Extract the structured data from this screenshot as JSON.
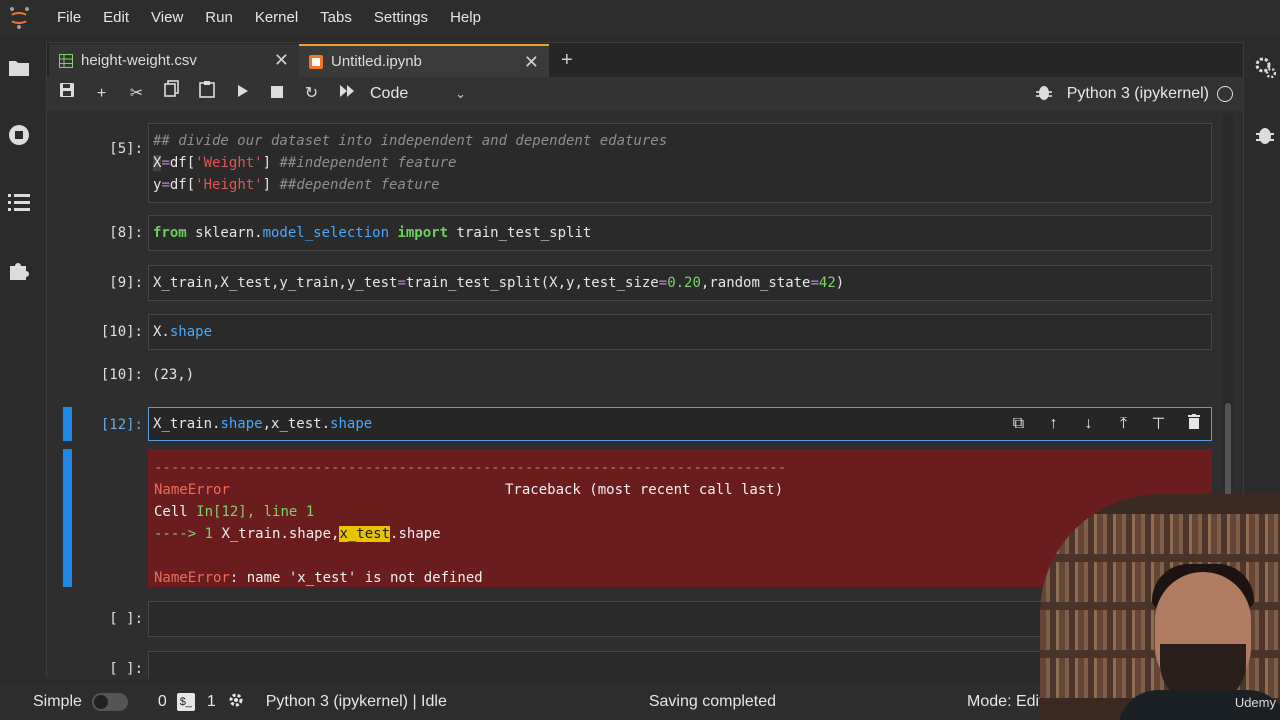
{
  "menubar": {
    "items": [
      "File",
      "Edit",
      "View",
      "Run",
      "Kernel",
      "Tabs",
      "Settings",
      "Help"
    ]
  },
  "tabs": [
    {
      "label": "height-weight.csv",
      "icon": "table-icon",
      "active": false
    },
    {
      "label": "Untitled.ipynb",
      "icon": "notebook-icon",
      "active": true
    }
  ],
  "toolbar": {
    "cell_type": "Code",
    "kernel_name": "Python 3 (ipykernel)"
  },
  "cells": [
    {
      "prompt": "[5]:",
      "lines": [
        "## divide our dataset into independent and dependent edatures",
        "X=df['Weight'] ##independent feature",
        "y=df['Height'] ##dependent feature"
      ]
    },
    {
      "prompt": "[8]:",
      "lines": [
        "from sklearn.model_selection import train_test_split"
      ]
    },
    {
      "prompt": "[9]:",
      "lines": [
        "X_train,X_test,y_train,y_test=train_test_split(X,y,test_size=0.20,random_state=42)"
      ]
    },
    {
      "prompt": "[10]:",
      "lines": [
        "X.shape"
      ],
      "output_prompt": "[10]:",
      "output": "(23,)"
    },
    {
      "prompt": "[12]:",
      "lines": [
        "X_train.shape,x_test.shape"
      ],
      "error": {
        "dashes": "---------------------------------------------------------------------------",
        "name": "NameError",
        "traceback_label": "Traceback (most recent call last)",
        "cell_ref_prefix": "Cell ",
        "cell_ref": "In[12], line 1",
        "arrow": "----> 1 ",
        "code_before": "X_train.shape,",
        "code_highlight": "x_test",
        "code_after": ".shape",
        "message_name": "NameError",
        "message": ": name 'x_test' is not defined"
      }
    },
    {
      "prompt": "[ ]:",
      "lines": [
        ""
      ]
    },
    {
      "prompt": "[ ]:",
      "lines": [
        ""
      ]
    }
  ],
  "statusbar": {
    "mode_label": "Simple",
    "count_a": "0",
    "count_b": "1",
    "kernel_status": "Python 3 (ipykernel) | Idle",
    "save_status": "Saving completed",
    "edit_mode": "Mode: Edit"
  },
  "overlay": {
    "brand": "Udemy"
  },
  "colors": {
    "accent_blue": "#1e88e5",
    "error_bg": "#6b1d1d",
    "highlight": "#e6c400",
    "tab_accent": "#f0a030"
  }
}
